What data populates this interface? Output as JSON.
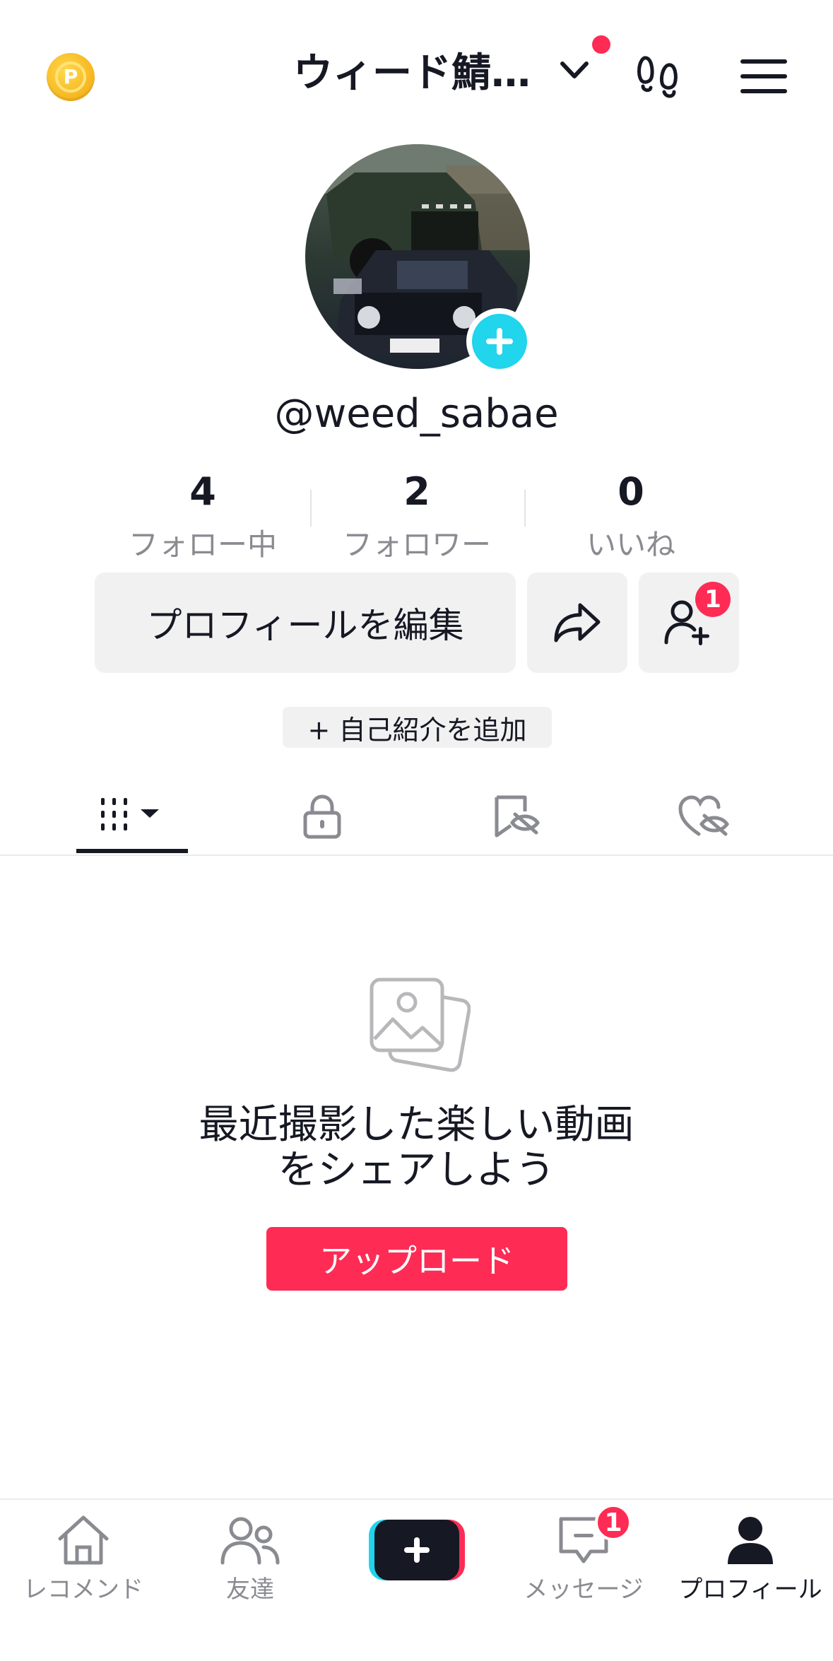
{
  "header": {
    "coin_icon": "coin-icon",
    "coin_letter": "P",
    "account_name": "ウィード鯖…",
    "accent_dot_color": "#fe2c55"
  },
  "profile": {
    "username": "@weed_sabae",
    "stats": [
      {
        "value": "4",
        "label": "フォロー中"
      },
      {
        "value": "2",
        "label": "フォロワー"
      },
      {
        "value": "0",
        "label": "いいね"
      }
    ],
    "edit_label": "プロフィールを編集",
    "friend_badge_count": "1",
    "bio_label": "+ 自己紹介を追加"
  },
  "tabs": [
    {
      "icon": "grid-icon",
      "active": true
    },
    {
      "icon": "lock-icon",
      "active": false
    },
    {
      "icon": "bookmark-hidden-icon",
      "active": false
    },
    {
      "icon": "heart-hidden-icon",
      "active": false
    }
  ],
  "empty_state": {
    "line1": "最近撮影した楽しい動画",
    "line2": "をシェアしよう",
    "upload_label": "アップロード"
  },
  "bottom_nav": {
    "items": [
      {
        "label": "レコメンド",
        "icon": "home-icon"
      },
      {
        "label": "友達",
        "icon": "friends-icon"
      },
      {
        "label": "",
        "icon": "create-icon"
      },
      {
        "label": "メッセージ",
        "icon": "message-icon"
      },
      {
        "label": "プロフィール",
        "icon": "profile-icon"
      }
    ],
    "message_badge": "1"
  },
  "colors": {
    "accent": "#fe2c55",
    "cyan": "#20d5ec",
    "text": "#161823",
    "muted": "#8a8b91"
  }
}
